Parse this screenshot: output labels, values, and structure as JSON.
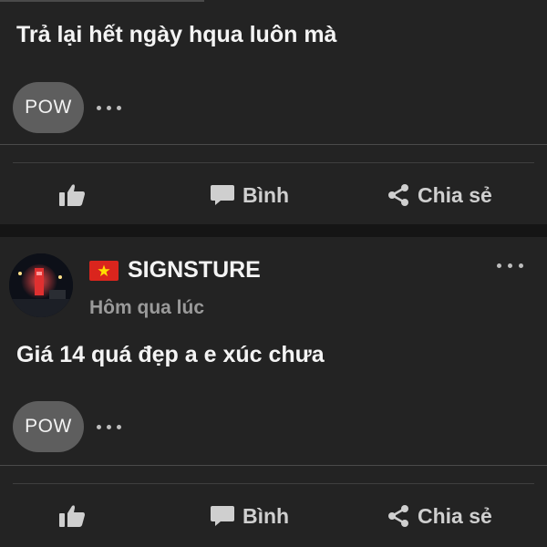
{
  "feed": {
    "post1": {
      "text": "Trả lại hết ngày hqua luôn mà",
      "pow_label": "POW",
      "actions": {
        "comment": "Bình",
        "share": "Chia sẻ"
      }
    },
    "post2": {
      "author": "SIGNSTURE",
      "timestamp": "Hôm qua lúc",
      "text": "Giá 14 quá đẹp a e xúc chưa",
      "pow_label": "POW",
      "actions": {
        "comment": "Bình",
        "share": "Chia sẻ"
      }
    }
  },
  "icons": {
    "like": "thumbs-up-icon",
    "comment": "comment-bubble-icon",
    "share": "share-icon",
    "more": "more-dots-icon",
    "flag": "vietnam-flag-icon"
  },
  "colors": {
    "background": "#232323",
    "separator": "#151515",
    "pow_button": "#5e5e5e",
    "action_text": "#cfcfcf",
    "timestamp": "#9a9a9a",
    "flag_red": "#da251d",
    "flag_star": "#ffde00"
  }
}
